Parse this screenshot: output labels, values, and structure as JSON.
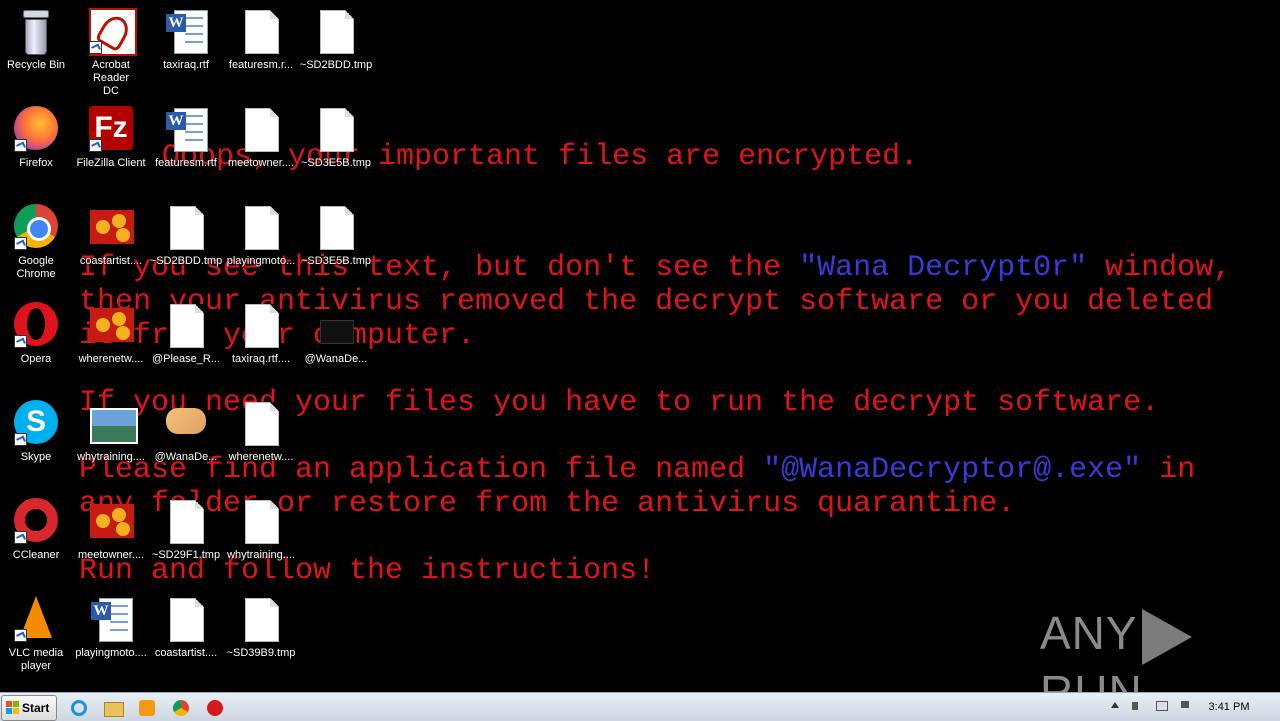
{
  "desktop": {
    "wallpaper": {
      "headline": "Ooops, your important files are encrypted.",
      "line1_pre": "If you see this text, but don't see the ",
      "line1_blue": "\"Wana Decrypt0r\"",
      "line1_post": " window,",
      "line2": "then your antivirus removed the decrypt software or you deleted",
      "line3": "it from your computer.",
      "line4": "If you need your files you have to run the decrypt software.",
      "line5_pre": "Please find an application file named ",
      "line5_blue": "\"@WanaDecryptor@.exe\"",
      "line5_post": " in",
      "line6": "any folder or restore from the antivirus quarantine.",
      "line7": "Run and follow the instructions!",
      "text_color": "#e0141b",
      "highlight_color": "#3a3ad6"
    },
    "icons": [
      {
        "label": "Recycle Bin",
        "type": "recycle-bin"
      },
      {
        "label": "Acrobat Reader DC",
        "type": "acrobat"
      },
      {
        "label": "taxiraq.rtf",
        "type": "word"
      },
      {
        "label": "featuresm.r...",
        "type": "document"
      },
      {
        "label": "~SD2BDD.tmp",
        "type": "document"
      },
      {
        "label": "Firefox",
        "type": "firefox"
      },
      {
        "label": "FileZilla Client",
        "type": "filezilla"
      },
      {
        "label": "featuresm.rtf",
        "type": "word"
      },
      {
        "label": "meetowner....",
        "type": "document"
      },
      {
        "label": "~SD3E5B.tmp",
        "type": "document"
      },
      {
        "label": "Google Chrome",
        "type": "chrome"
      },
      {
        "label": "coastartist....",
        "type": "flower-image"
      },
      {
        "label": "~SD2BDD.tmp",
        "type": "document"
      },
      {
        "label": "playingmoto...",
        "type": "document"
      },
      {
        "label": "~SD3E5B.tmp",
        "type": "document"
      },
      {
        "label": "Opera",
        "type": "opera"
      },
      {
        "label": "wherenetw....",
        "type": "flower-image"
      },
      {
        "label": "@Please_R...",
        "type": "document"
      },
      {
        "label": "taxiraq.rtf....",
        "type": "document"
      },
      {
        "label": "@WanaDe...",
        "type": "blank"
      },
      {
        "label": "Skype",
        "type": "skype"
      },
      {
        "label": "whytraining....",
        "type": "landscape-image"
      },
      {
        "label": "@WanaDe...",
        "type": "handshake"
      },
      {
        "label": "wherenetw....",
        "type": "document"
      },
      {
        "label": "CCleaner",
        "type": "ccleaner"
      },
      {
        "label": "meetowner....",
        "type": "flower-image"
      },
      {
        "label": "~SD29F1.tmp",
        "type": "document"
      },
      {
        "label": "whytraining....",
        "type": "document"
      },
      {
        "label": "VLC media player",
        "type": "vlc"
      },
      {
        "label": "playingmoto....",
        "type": "word"
      },
      {
        "label": "coastartist....",
        "type": "document"
      },
      {
        "label": "~SD39B9.tmp",
        "type": "document"
      }
    ],
    "watermark": {
      "left": "ANY",
      "right": "RUN"
    }
  },
  "taskbar": {
    "start_label": "Start",
    "pinned": [
      "internet-explorer-icon",
      "file-explorer-icon",
      "media-player-icon",
      "chrome-icon",
      "opera-icon"
    ],
    "tray": [
      "show-hidden-icons",
      "volume-icon",
      "network-icon",
      "action-center-flag-icon"
    ],
    "clock": "3:41 PM"
  }
}
